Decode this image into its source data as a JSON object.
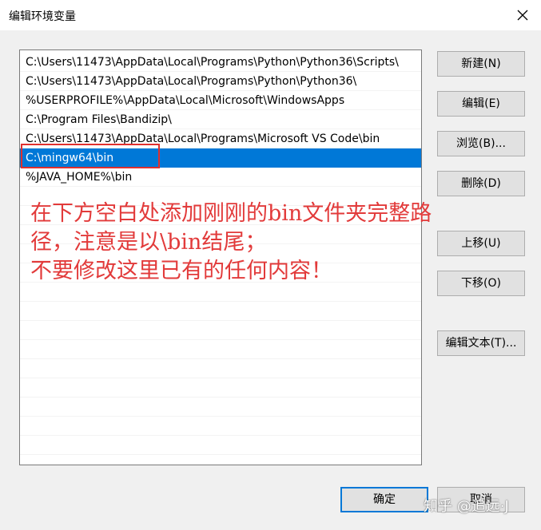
{
  "window": {
    "title": "编辑环境变量"
  },
  "list": {
    "items": [
      "C:\\Users\\11473\\AppData\\Local\\Programs\\Python\\Python36\\Scripts\\",
      "C:\\Users\\11473\\AppData\\Local\\Programs\\Python\\Python36\\",
      "%USERPROFILE%\\AppData\\Local\\Microsoft\\WindowsApps",
      "C:\\Program Files\\Bandizip\\",
      "C:\\Users\\11473\\AppData\\Local\\Programs\\Microsoft VS Code\\bin",
      "C:\\mingw64\\bin",
      "%JAVA_HOME%\\bin"
    ],
    "selected_index": 5
  },
  "annotation": {
    "line1": "在下方空白处添加刚刚的bin文件夹完整路",
    "line2": "径，注意是以\\bin结尾；",
    "line3": "不要修改这里已有的任何内容！",
    "color": "#e23a3a"
  },
  "buttons": {
    "new": "新建(N)",
    "edit": "编辑(E)",
    "browse": "浏览(B)...",
    "delete": "删除(D)",
    "move_up": "上移(U)",
    "move_down": "下移(O)",
    "edit_text": "编辑文本(T)...",
    "ok": "确定",
    "cancel": "取消"
  },
  "watermark": "知乎 @追远·J",
  "colors": {
    "selection": "#0078d7",
    "highlight_border": "#e0302e"
  }
}
